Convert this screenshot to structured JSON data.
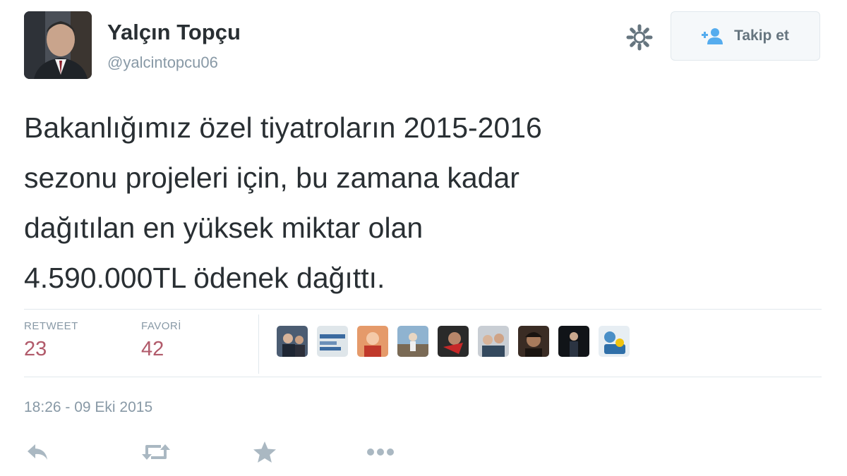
{
  "user": {
    "display_name": "Yalçın Topçu",
    "handle": "@yalcintopcu06"
  },
  "follow_button": {
    "label": "Takip et",
    "icon": "follow-user-icon"
  },
  "settings": {
    "icon": "gear-icon"
  },
  "tweet": {
    "lines": [
      "Bakanlığımız özel tiyatroların 2015-2016",
      "sezonu projeleri için, bu zamana kadar",
      "dağıtılan en yüksek miktar olan",
      "4.590.000TL ödenek dağıttı."
    ]
  },
  "stats": {
    "retweet": {
      "label": "RETWEET",
      "value": "23"
    },
    "favorite": {
      "label": "FAVORİ",
      "value": "42"
    }
  },
  "favorited_by_count_shown": 9,
  "timestamp": "18:26 - 09 Eki 2015",
  "actions": {
    "reply": "reply-icon",
    "retweet": "retweet-icon",
    "favorite": "star-icon",
    "more": "more-icon"
  },
  "colors": {
    "text": "#292f33",
    "muted": "#8899a6",
    "stat_value": "#b15a6a",
    "border": "#e1e8ed"
  }
}
